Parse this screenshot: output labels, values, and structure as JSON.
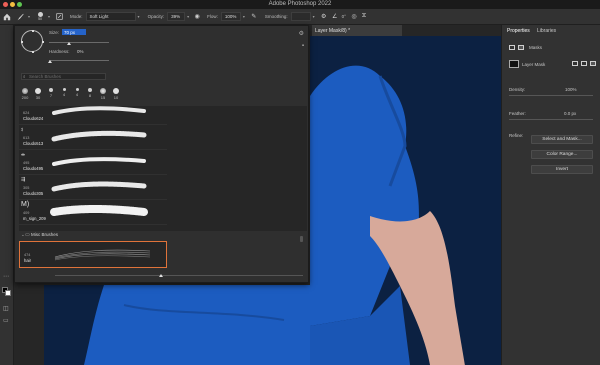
{
  "app": {
    "title": "Adobe Photoshop 2022"
  },
  "options_bar": {
    "brush_size": "50",
    "mode_label": "Mode:",
    "mode_value": "Soft Light",
    "opacity_label": "Opacity:",
    "opacity_value": "39%",
    "flow_label": "Flow:",
    "flow_value": "100%",
    "smoothing_label": "Smoothing:",
    "smoothing_value": "",
    "angle_value": "0°"
  },
  "document": {
    "tab_title": "Layer Mask/8) *"
  },
  "brush_picker": {
    "size_label": "Size:",
    "size_value": "70 px",
    "hardness_label": "Hardness:",
    "hardness_value": "0%",
    "search_placeholder": "Search Brushes",
    "recent_sizes": [
      "200",
      "30",
      "7",
      "4",
      "4",
      "8",
      "15",
      "10"
    ],
    "brushes": [
      {
        "num": "624",
        "name": "Cloudo624"
      },
      {
        "num": "613",
        "name": "Cloudo513"
      },
      {
        "num": "495",
        "name": "Cloudo495"
      },
      {
        "num": "305",
        "name": "Cloudo305"
      },
      {
        "num": "409",
        "name": "m_sign_209"
      }
    ],
    "group_label": "Misc Brushes",
    "selected_brush": {
      "num": "474",
      "name": "hair"
    }
  },
  "panels": {
    "tabs": [
      "Properties",
      "Libraries"
    ],
    "masks_label": "Masks",
    "layer_mask_label": "Layer Mask",
    "density_label": "Density:",
    "density_value": "100%",
    "feather_label": "Feather:",
    "feather_value": "0.0 px",
    "refine_label": "Refine:",
    "select_and_mask": "Select and Mask...",
    "color_range": "Color Range...",
    "invert": "Invert"
  },
  "colors": {
    "background": "#0c2142",
    "shirt": "#1c5cc0",
    "skin": "#d7a99a",
    "selection": "#e0733a",
    "field_highlight": "#2563c9"
  }
}
